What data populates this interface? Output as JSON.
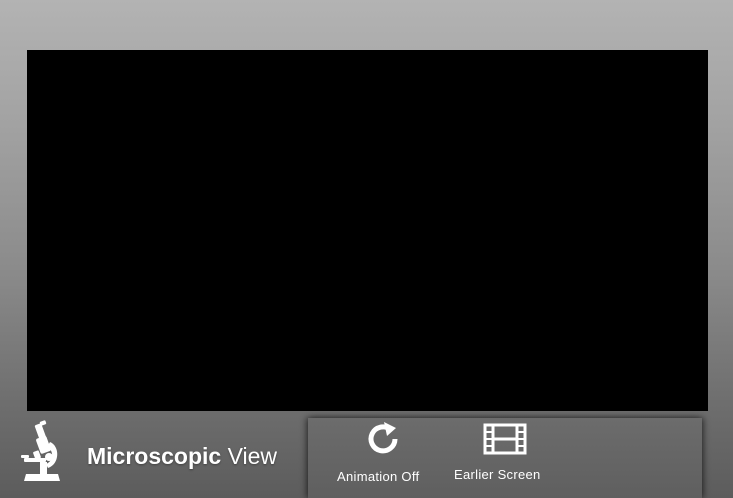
{
  "brand": {
    "title_strong": "Microscopic",
    "title_light": "View",
    "icon": "microscope-icon"
  },
  "toolbar": {
    "animation_label": "Animation Off",
    "animation_icon": "refresh-icon",
    "earlier_label": "Earlier Screen",
    "earlier_icon": "film-strip-icon"
  },
  "colors": {
    "viewport_background": "#000000",
    "text": "#ffffff",
    "toolbar_background": "#656565"
  }
}
